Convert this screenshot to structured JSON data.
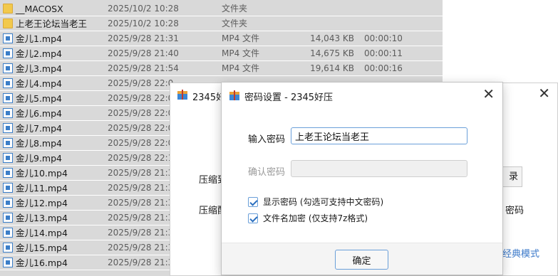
{
  "explorer": {
    "files": [
      {
        "name": "__MACOSX",
        "date": "2025/10/2 10:28",
        "type": "文件夹",
        "size": "",
        "duration": "",
        "kind": "folder"
      },
      {
        "name": "上老王论坛当老王",
        "date": "2025/10/2 10:28",
        "type": "文件夹",
        "size": "",
        "duration": "",
        "kind": "folder"
      },
      {
        "name": "金儿1.mp4",
        "date": "2025/9/28 21:31",
        "type": "MP4 文件",
        "size": "14,043 KB",
        "duration": "00:00:10",
        "kind": "mp4"
      },
      {
        "name": "金儿2.mp4",
        "date": "2025/9/28 21:40",
        "type": "MP4 文件",
        "size": "14,675 KB",
        "duration": "00:00:11",
        "kind": "mp4"
      },
      {
        "name": "金儿3.mp4",
        "date": "2025/9/28 21:54",
        "type": "MP4 文件",
        "size": "19,614 KB",
        "duration": "00:00:16",
        "kind": "mp4"
      },
      {
        "name": "金儿4.mp4",
        "date": "2025/9/28 22:0",
        "type": "",
        "size": "",
        "duration": "",
        "kind": "mp4"
      },
      {
        "name": "金儿5.mp4",
        "date": "2025/9/28 22:0",
        "type": "",
        "size": "",
        "duration": "",
        "kind": "mp4"
      },
      {
        "name": "金儿6.mp4",
        "date": "2025/9/28 22:0",
        "type": "",
        "size": "",
        "duration": "",
        "kind": "mp4"
      },
      {
        "name": "金儿7.mp4",
        "date": "2025/9/28 22:0",
        "type": "",
        "size": "",
        "duration": "",
        "kind": "mp4"
      },
      {
        "name": "金儿8.mp4",
        "date": "2025/9/28 22:0",
        "type": "",
        "size": "",
        "duration": "",
        "kind": "mp4"
      },
      {
        "name": "金儿9.mp4",
        "date": "2025/9/28 22:1",
        "type": "",
        "size": "",
        "duration": "",
        "kind": "mp4"
      },
      {
        "name": "金儿10.mp4",
        "date": "2025/9/28 21:3",
        "type": "",
        "size": "",
        "duration": "",
        "kind": "mp4"
      },
      {
        "name": "金儿11.mp4",
        "date": "2025/9/28 21:3",
        "type": "",
        "size": "",
        "duration": "",
        "kind": "mp4"
      },
      {
        "name": "金儿12.mp4",
        "date": "2025/9/28 21:3",
        "type": "",
        "size": "",
        "duration": "",
        "kind": "mp4"
      },
      {
        "name": "金儿13.mp4",
        "date": "2025/9/28 21:3",
        "type": "",
        "size": "",
        "duration": "",
        "kind": "mp4"
      },
      {
        "name": "金儿14.mp4",
        "date": "2025/9/28 21:3",
        "type": "",
        "size": "",
        "duration": "",
        "kind": "mp4"
      },
      {
        "name": "金儿15.mp4",
        "date": "2025/9/28 21:3",
        "type": "",
        "size": "",
        "duration": "",
        "kind": "mp4"
      },
      {
        "name": "金儿16.mp4",
        "date": "2025/9/28 21:3",
        "type": "",
        "size": "",
        "duration": "",
        "kind": "mp4"
      }
    ]
  },
  "main_dialog": {
    "title": "2345好",
    "label_1": "压缩到",
    "label_2": "压缩配",
    "browse_label": "录",
    "right_text": "密码",
    "classic_mode_link": "经典模式"
  },
  "password_dialog": {
    "title": "密码设置 - 2345好压",
    "password_label": "输入密码",
    "password_value": "上老王论坛当老王",
    "confirm_label": "确认密码",
    "confirm_value": "",
    "show_password_label": "显示密码 (勾选可支持中文密码)",
    "show_password_checked": true,
    "encrypt_filenames_label": "文件名加密 (仅支持7z格式)",
    "encrypt_filenames_checked": true,
    "ok_label": "确定"
  },
  "colors": {
    "list_background": "#d9d9d9",
    "accent": "#6a9fd9",
    "link": "#3a78c9"
  }
}
